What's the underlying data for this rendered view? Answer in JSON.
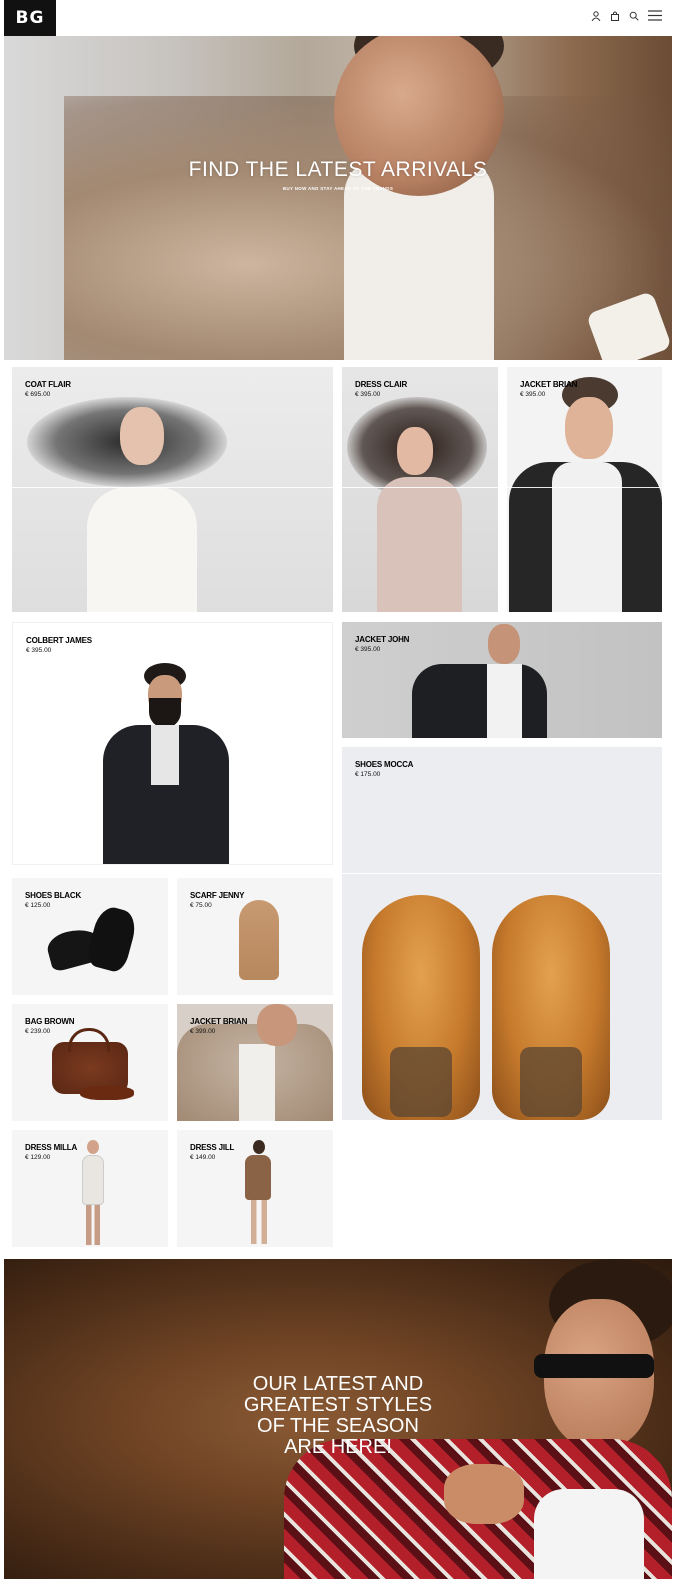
{
  "header": {
    "logo": "BG",
    "icons": [
      "user-icon",
      "bag-icon",
      "search-icon",
      "menu-icon"
    ]
  },
  "hero": {
    "title": "FIND THE LATEST ARRIVALS",
    "subtitle": "BUY NOW AND STAY AHEAD OF THE TRENDS"
  },
  "products": [
    {
      "name": "COAT FLAIR",
      "price": "€ 695.00"
    },
    {
      "name": "DRESS CLAIR",
      "price": "€ 395.00"
    },
    {
      "name": "JACKET BRIAN",
      "price": "€ 395.00"
    },
    {
      "name": "COLBERT JAMES",
      "price": "€ 395.00"
    },
    {
      "name": "JACKET JOHN",
      "price": "€ 395.00"
    },
    {
      "name": "SHOES MOCCA",
      "price": "€ 175.00"
    },
    {
      "name": "SHOES BLACK",
      "price": "€ 125.00"
    },
    {
      "name": "SCARF JENNY",
      "price": "€ 75.00"
    },
    {
      "name": "BAG BROWN",
      "price": "€ 239.00"
    },
    {
      "name": "JACKET BRIAN",
      "price": "€ 399.00"
    },
    {
      "name": "DRESS MILLA",
      "price": "€ 129.00"
    },
    {
      "name": "DRESS JILL",
      "price": "€ 149.00"
    }
  ],
  "banner": {
    "line1": "OUR LATEST AND",
    "line2": "GREATEST STYLES",
    "line3": "OF THE SEASON",
    "line4": "ARE HERE!"
  },
  "colors": {
    "logo_bg": "#111111",
    "text": "#000000",
    "tile_bg": "#f4f4f4"
  }
}
